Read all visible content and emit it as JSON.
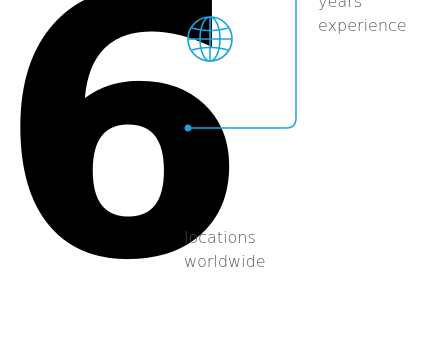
{
  "hero": {
    "number": "6"
  },
  "experience": {
    "line1": "years",
    "line2": "experience"
  },
  "locations": {
    "line1": "locations",
    "line2": "worldwide"
  },
  "icons": {
    "globe": "globe-icon"
  },
  "colors": {
    "accent": "#1aa3e0",
    "number": "#000000",
    "text": "#555555"
  }
}
